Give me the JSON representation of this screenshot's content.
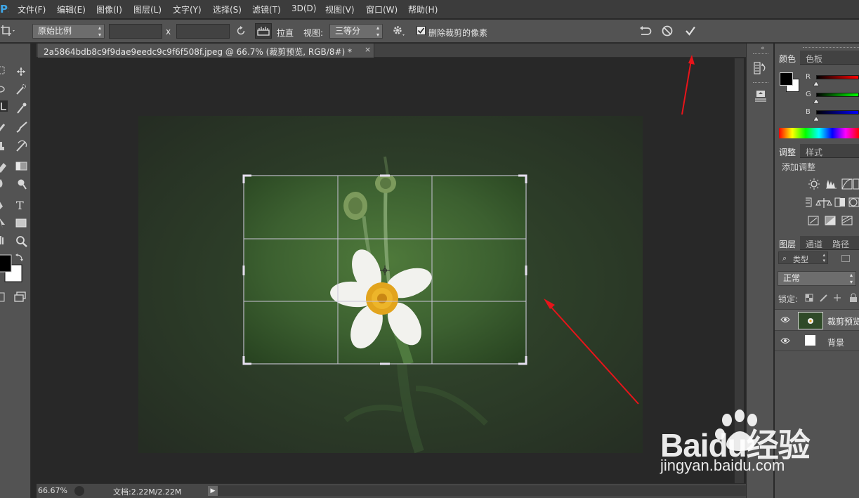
{
  "menu": [
    "文件(F)",
    "编辑(E)",
    "图像(I)",
    "图层(L)",
    "文字(Y)",
    "选择(S)",
    "滤镜(T)",
    "3D(D)",
    "视图(V)",
    "窗口(W)",
    "帮助(H)"
  ],
  "options": {
    "ratio_value": "原始比例",
    "by_sign": "x",
    "straighten_label": "拉直",
    "view_label": "视图:",
    "view_value": "三等分",
    "delete_cropped_label": "删除裁剪的像素",
    "delete_cropped_checked": true
  },
  "document": {
    "tab_title": "2a5864bdb8c9f9dae9eedc9c9f6f508f.jpeg @ 66.7% (裁剪预览, RGB/8#) *",
    "tab_close": "×"
  },
  "status": {
    "zoom": "66.67%",
    "doc_info": "文档:2.22M/2.22M"
  },
  "color_panel": {
    "tabs": [
      "颜色",
      "色板"
    ],
    "channels": [
      "R",
      "G",
      "B"
    ]
  },
  "adjust_panel": {
    "tabs": [
      "调整",
      "样式"
    ],
    "heading": "添加调整"
  },
  "layers_panel": {
    "tabs": [
      "图层",
      "通道",
      "路径"
    ],
    "filter_value": "类型",
    "blend_mode": "正常",
    "lock_label": "锁定:",
    "layers": [
      {
        "name": "裁剪预览",
        "visible": true,
        "selected": true
      },
      {
        "name": "背景",
        "visible": true,
        "selected": false
      }
    ]
  },
  "watermark": {
    "brand": "Baidu经验",
    "url": "jingyan.baidu.com"
  },
  "colors": {
    "ui_dark": "#282828",
    "ui_panel": "#535353",
    "accent_arrow": "#e8141a",
    "photo_green": "#34532a"
  }
}
